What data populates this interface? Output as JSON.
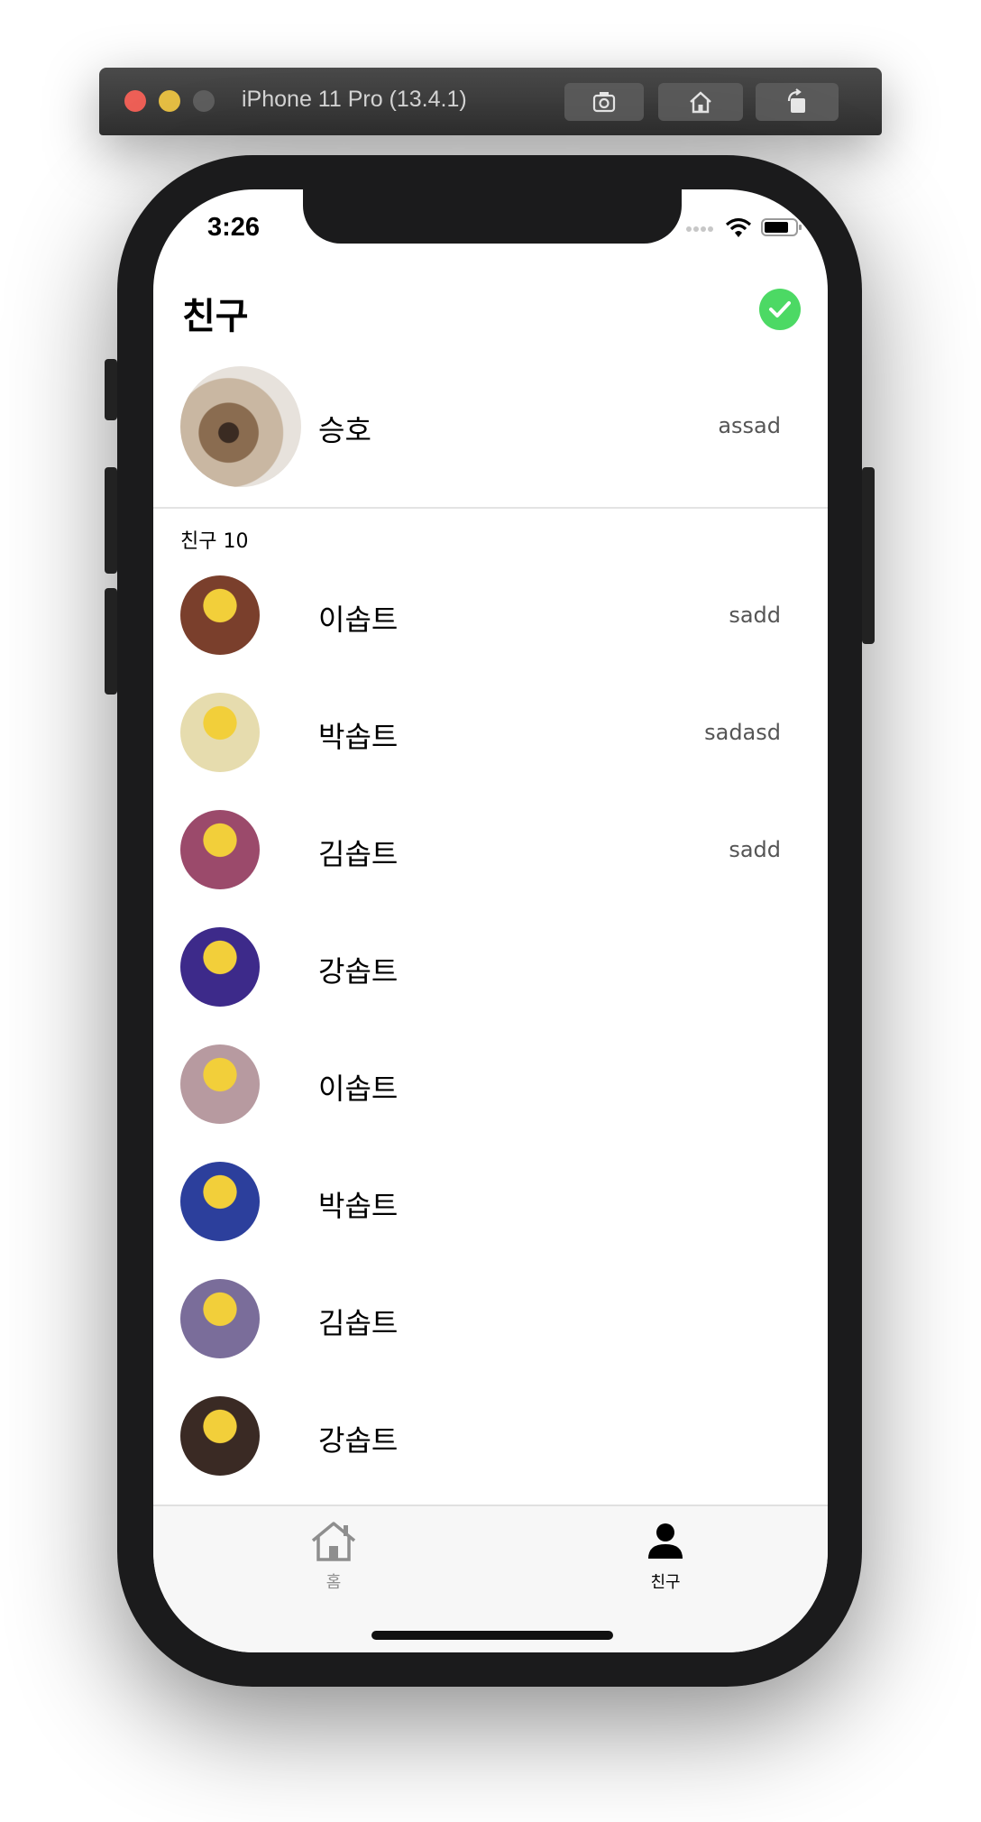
{
  "simulator": {
    "title": "iPhone 11 Pro (13.4.1)",
    "buttons": [
      "screenshot-icon",
      "home-icon",
      "rotate-icon"
    ]
  },
  "status_bar": {
    "time": "3:26"
  },
  "header": {
    "title": "친구",
    "action_icon": "check-icon",
    "action_color": "#4cd964"
  },
  "me": {
    "name": "승호",
    "status": "assad"
  },
  "friends_section": {
    "label": "친구 10",
    "items": [
      {
        "name": "이솝트",
        "status": "sadd",
        "avatar_color": "#7a3f2c"
      },
      {
        "name": "박솝트",
        "status": "sadasd",
        "avatar_color": "#e6dcae"
      },
      {
        "name": "김솝트",
        "status": "sadd",
        "avatar_color": "#9b4a6b"
      },
      {
        "name": "강솝트",
        "status": "",
        "avatar_color": "#3d2a8a"
      },
      {
        "name": "이솝트",
        "status": "",
        "avatar_color": "#b79aa0"
      },
      {
        "name": "박솝트",
        "status": "",
        "avatar_color": "#2c3f9c"
      },
      {
        "name": "김솝트",
        "status": "",
        "avatar_color": "#7a6d9a"
      },
      {
        "name": "강솝트",
        "status": "",
        "avatar_color": "#3a2a24"
      }
    ]
  },
  "tab_bar": {
    "tabs": [
      {
        "label": "홈",
        "icon": "home-icon",
        "active": false
      },
      {
        "label": "친구",
        "icon": "person-icon",
        "active": true
      }
    ]
  }
}
